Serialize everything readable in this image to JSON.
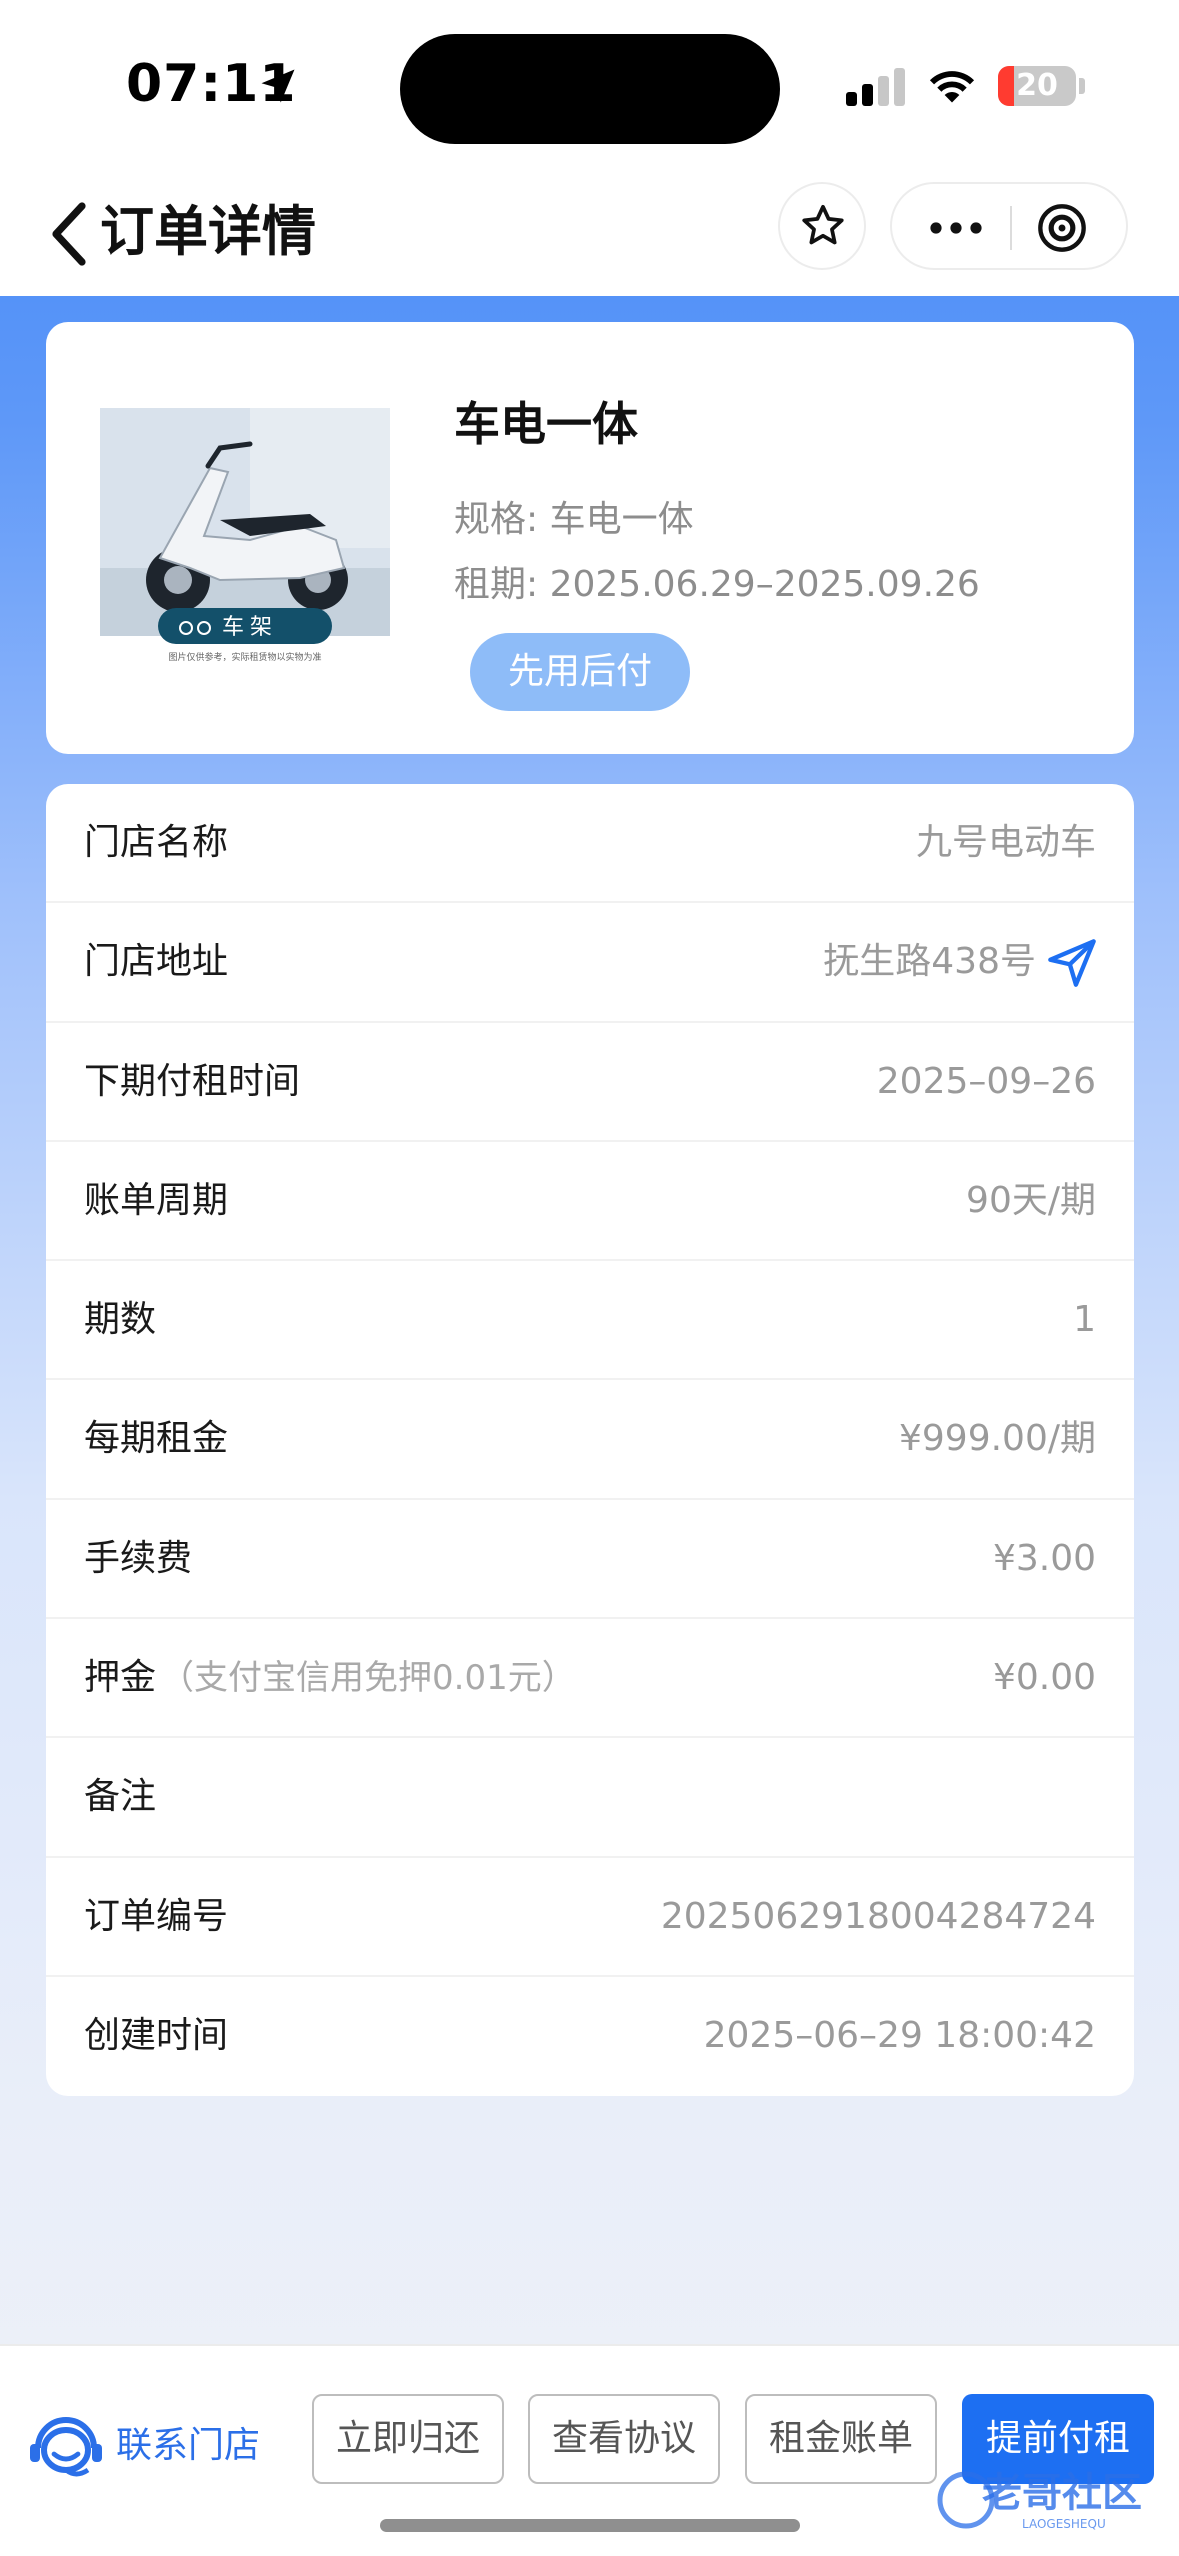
{
  "status_bar": {
    "time": "07:11",
    "battery_level": "20",
    "colors": {
      "battery_low": "#ff3b30"
    }
  },
  "nav": {
    "title": "订单详情"
  },
  "product": {
    "image_label": "车架",
    "image_caption": "图片仅供参考，实际租赁物以实物为准",
    "name": "车电一体",
    "spec": "规格: 车电一体",
    "term": "租期: 2025.06.29–2025.09.26",
    "badge": "先用后付"
  },
  "details": {
    "rows": [
      {
        "label": "门店名称",
        "value": "九号电动车"
      },
      {
        "label": "门店地址",
        "value": "抚生路438号",
        "icon": "navigation-arrow-icon"
      },
      {
        "label": "下期付租时间",
        "value": "2025–09–26"
      },
      {
        "label": "账单周期",
        "value": "90天/期"
      },
      {
        "label": "期数",
        "value": "1"
      },
      {
        "label": "每期租金",
        "value": "¥999.00/期"
      },
      {
        "label": "手续费",
        "value": "¥3.00"
      },
      {
        "label": "押金",
        "note": "（支付宝信用免押0.01元）",
        "value": "¥0.00"
      },
      {
        "label": "备注",
        "value": ""
      },
      {
        "label": "订单编号",
        "value": "2025062918004284724"
      },
      {
        "label": "创建时间",
        "value": "2025–06–29 18:00:42"
      }
    ]
  },
  "actions": {
    "contact_store": "联系门店",
    "return_now": "立即归还",
    "view_agreement": "查看协议",
    "rent_bill": "租金账单",
    "pay_early": "提前付租"
  },
  "watermark": {
    "text": "老哥社区",
    "subtext": "LAOGESHEQU"
  },
  "colors": {
    "primary": "#1d6ff2",
    "header_blue": "#3f86f7",
    "badge": "#8ebcf8",
    "muted_text": "#9a9a9a"
  }
}
